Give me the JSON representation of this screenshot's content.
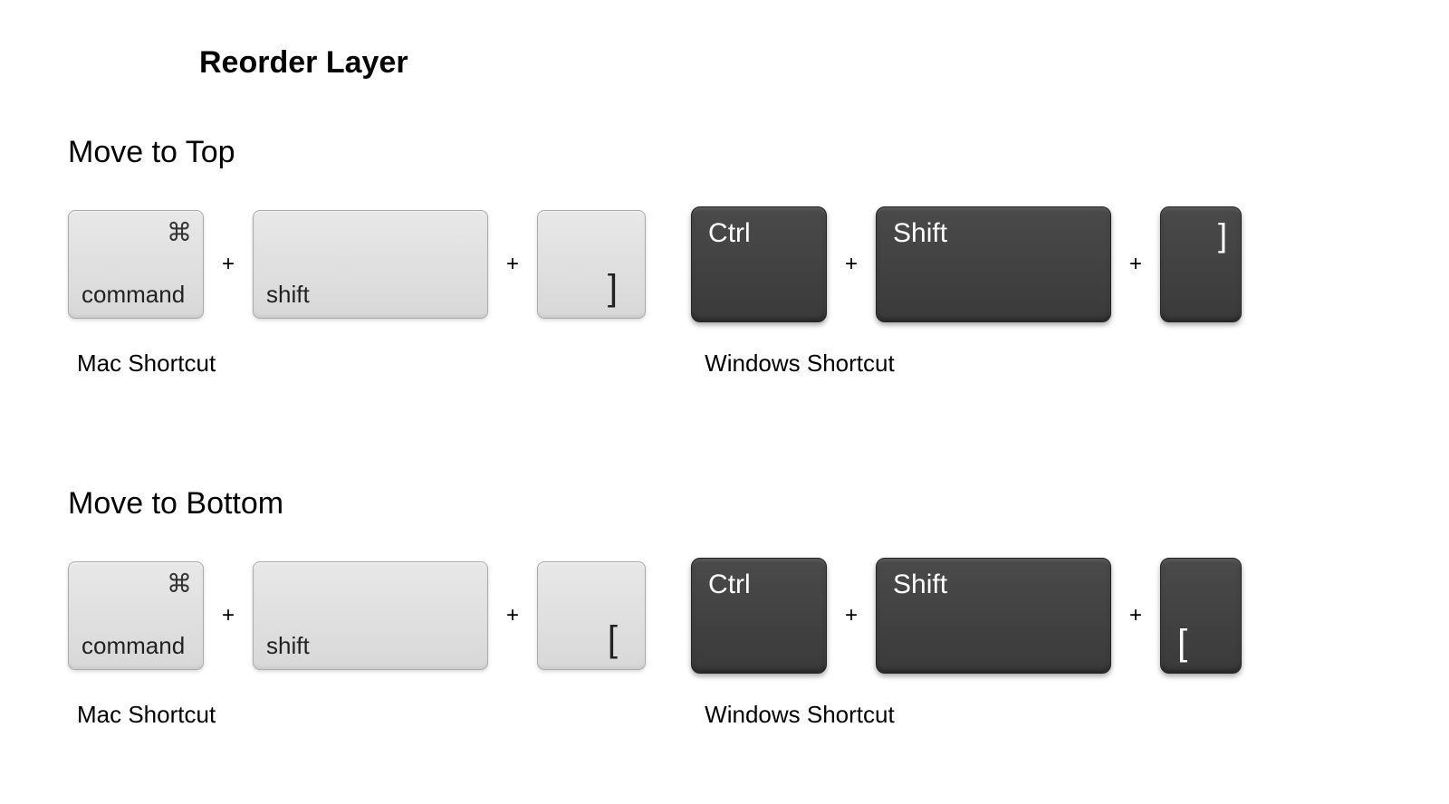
{
  "title": "Reorder Layer",
  "sections": [
    {
      "heading": "Move to Top",
      "mac": {
        "key1_label": "command",
        "key1_icon": "⌘",
        "key2_label": "shift",
        "key3_label": "]"
      },
      "win": {
        "key1_label": "Ctrl",
        "key2_label": "Shift",
        "key3_label": "]"
      },
      "mac_caption": "Mac Shortcut",
      "win_caption": "Windows Shortcut",
      "plus": "+"
    },
    {
      "heading": "Move to Bottom",
      "mac": {
        "key1_label": "command",
        "key1_icon": "⌘",
        "key2_label": "shift",
        "key3_label": "["
      },
      "win": {
        "key1_label": "Ctrl",
        "key2_label": "Shift",
        "key3_label": "["
      },
      "mac_caption": "Mac Shortcut",
      "win_caption": "Windows Shortcut",
      "plus": "+"
    }
  ]
}
